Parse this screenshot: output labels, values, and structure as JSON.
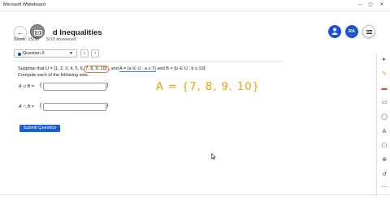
{
  "window": {
    "title": "Microsoft Whiteboard",
    "minimize": "–",
    "maximize": "▢",
    "close": "✕"
  },
  "header": {
    "title_partial_left": "p",
    "title_partial_right": "d Inequalities",
    "score": "Score: 15/30",
    "answered": "5/10 answered",
    "avatar_initials": "RA"
  },
  "question_nav": {
    "selected": "Question 9",
    "prev": "‹",
    "next": "›"
  },
  "problem": {
    "line1_a": "Suppose that ",
    "U_def_a": "U = {1, 2, 3, 4, 5, 6,",
    "U_def_hl": "7, 8, 9, 10}",
    "line1_b": ", and ",
    "A_def": "A = {a ∈ U : a ≥ 7}",
    "line1_c": " and ",
    "B_def": "B = {b ∈ U : b ≤ 10}",
    "line1_d": ".",
    "line2": "Compute each of the following sets."
  },
  "answers": [
    {
      "label": "A ∪ B =",
      "value": ""
    },
    {
      "label": "A ∩ B =",
      "value": ""
    }
  ],
  "submit_label": "Submit Question",
  "annotation": {
    "text": "A = {7, 8, 9, 10}",
    "color": "#f0a000"
  },
  "colors": {
    "accent": "#1a5fd0",
    "highlight": "#e07b39"
  }
}
